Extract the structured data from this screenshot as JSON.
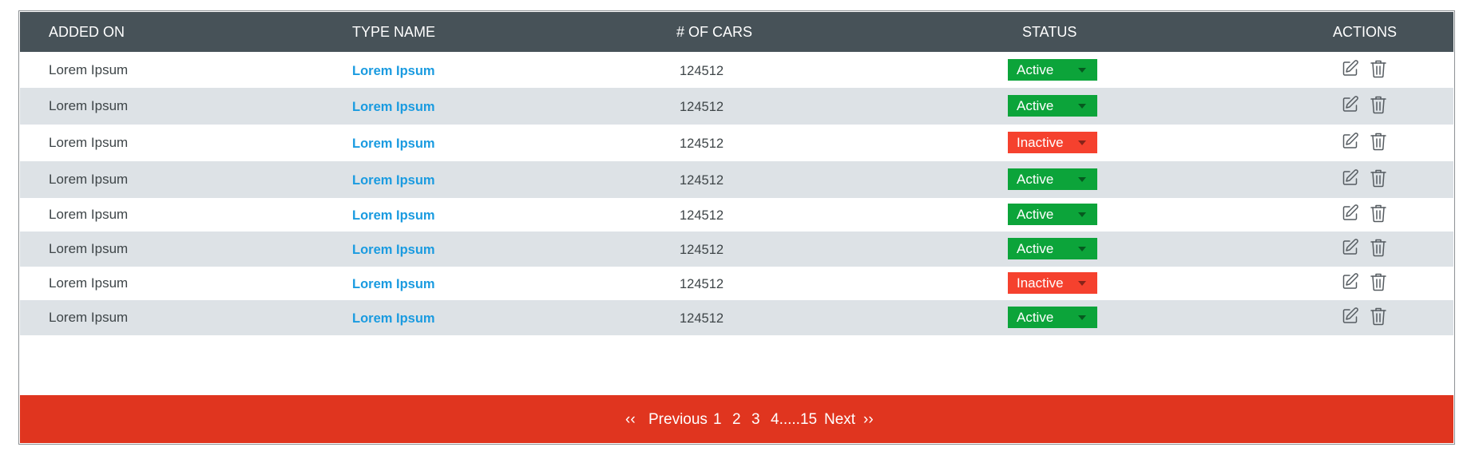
{
  "table": {
    "columns": [
      "ADDED ON",
      "TYPE NAME",
      "# OF CARS",
      "STATUS",
      "ACTIONS"
    ],
    "rows": [
      {
        "added_on": "Lorem Ipsum",
        "type_name": "Lorem Ipsum",
        "cars": "124512",
        "status": "Active"
      },
      {
        "added_on": "Lorem Ipsum",
        "type_name": "Lorem Ipsum",
        "cars": "124512",
        "status": "Active"
      },
      {
        "added_on": "Lorem Ipsum",
        "type_name": "Lorem Ipsum",
        "cars": "124512",
        "status": "Inactive"
      },
      {
        "added_on": "Lorem Ipsum",
        "type_name": "Lorem Ipsum",
        "cars": "124512",
        "status": "Active"
      },
      {
        "added_on": "Lorem Ipsum",
        "type_name": "Lorem Ipsum",
        "cars": "124512",
        "status": "Active"
      },
      {
        "added_on": "Lorem Ipsum",
        "type_name": "Lorem Ipsum",
        "cars": "124512",
        "status": "Active"
      },
      {
        "added_on": "Lorem Ipsum",
        "type_name": "Lorem Ipsum",
        "cars": "124512",
        "status": "Inactive"
      },
      {
        "added_on": "Lorem Ipsum",
        "type_name": "Lorem Ipsum",
        "cars": "124512",
        "status": "Active"
      }
    ],
    "row_icons": [
      "edit-icon",
      "trash-icon"
    ]
  },
  "pagination": {
    "first": "‹‹",
    "previous": "Previous",
    "pages": [
      "1",
      "2",
      "3",
      "4.....15"
    ],
    "next": "Next",
    "last": "››"
  },
  "colors": {
    "header_bg": "#475258",
    "row_alt_bg": "#dde2e6",
    "link": "#1a9be0",
    "status_active": "#0ca43a",
    "status_inactive": "#f5412e",
    "pager_bg": "#e0351f"
  }
}
